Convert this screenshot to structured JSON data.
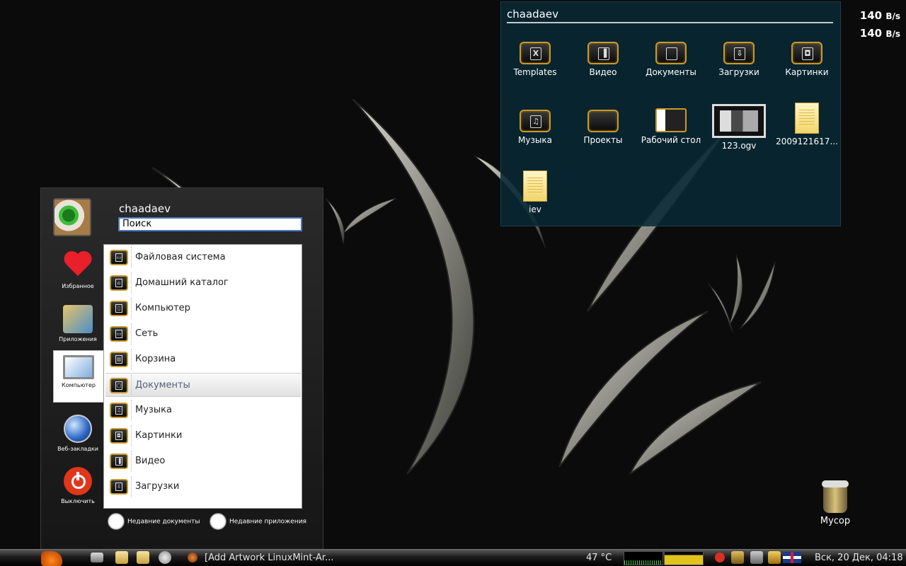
{
  "netspeed": {
    "download": {
      "value": "140",
      "unit": "B/s"
    },
    "upload": {
      "value": "140",
      "unit": "B/s"
    }
  },
  "folder_widget": {
    "title": "chaadaev",
    "items": [
      {
        "label": "Templates",
        "icon": "templates-icon",
        "glyph": "X"
      },
      {
        "label": "Видео",
        "icon": "video-folder-icon",
        "glyph": "▐"
      },
      {
        "label": "Документы",
        "icon": "documents-folder-icon",
        "glyph": ""
      },
      {
        "label": "Загрузки",
        "icon": "downloads-folder-icon",
        "glyph": "⇩"
      },
      {
        "label": "Картинки",
        "icon": "pictures-folder-icon",
        "glyph": "◘"
      },
      {
        "label": "Музыка",
        "icon": "music-folder-icon",
        "glyph": "♫"
      },
      {
        "label": "Проекты",
        "icon": "projects-folder-icon",
        "glyph": ""
      },
      {
        "label": "Рабочий стол",
        "icon": "desktop-folder-icon",
        "glyph": ""
      },
      {
        "label": "123.ogv",
        "icon": "video-file-icon",
        "glyph": ""
      },
      {
        "label": "2009121617...",
        "icon": "text-file-icon",
        "glyph": ""
      },
      {
        "label": "iev",
        "icon": "text-file-icon",
        "glyph": ""
      }
    ]
  },
  "menu": {
    "username": "chaadaev",
    "search_value": "Поиск",
    "categories": [
      {
        "label": "Избранное",
        "icon": "heart-icon"
      },
      {
        "label": "Приложения",
        "icon": "applications-icon"
      },
      {
        "label": "Компьютер",
        "icon": "computer-icon"
      },
      {
        "label": "Веб-закладки",
        "icon": "globe-icon"
      },
      {
        "label": "Выключить",
        "icon": "power-icon"
      }
    ],
    "places": [
      {
        "label": "Файловая система",
        "icon": "drive-icon",
        "glyph": "▭"
      },
      {
        "label": "Домашний каталог",
        "icon": "home-icon",
        "glyph": "⌂"
      },
      {
        "label": "Компьютер",
        "icon": "computer-icon",
        "glyph": "▯"
      },
      {
        "label": "Сеть",
        "icon": "network-icon",
        "glyph": "▭"
      },
      {
        "label": "Корзина",
        "icon": "trash-icon",
        "glyph": "▥"
      },
      {
        "label": "Документы",
        "icon": "documents-icon",
        "glyph": "▢"
      },
      {
        "label": "Музыка",
        "icon": "music-icon",
        "glyph": "♫"
      },
      {
        "label": "Картинки",
        "icon": "pictures-icon",
        "glyph": "◘"
      },
      {
        "label": "Видео",
        "icon": "video-icon",
        "glyph": "▐"
      },
      {
        "label": "Загрузки",
        "icon": "downloads-icon",
        "glyph": "⇩"
      }
    ],
    "selected_place": "Документы",
    "recent_documents": "Недавние документы",
    "recent_applications": "Недавние приложения"
  },
  "desktop": {
    "trash_label": "Мусор"
  },
  "panel": {
    "window_title": "[Add Artwork LinuxMint-Ar...",
    "temperature": "47 °C",
    "clock": "Вск, 20 Дек, 04:18"
  },
  "colors": {
    "widget_bg": "#082834",
    "accent_gold": "#c89a2a",
    "search_border": "#4b78c4"
  }
}
